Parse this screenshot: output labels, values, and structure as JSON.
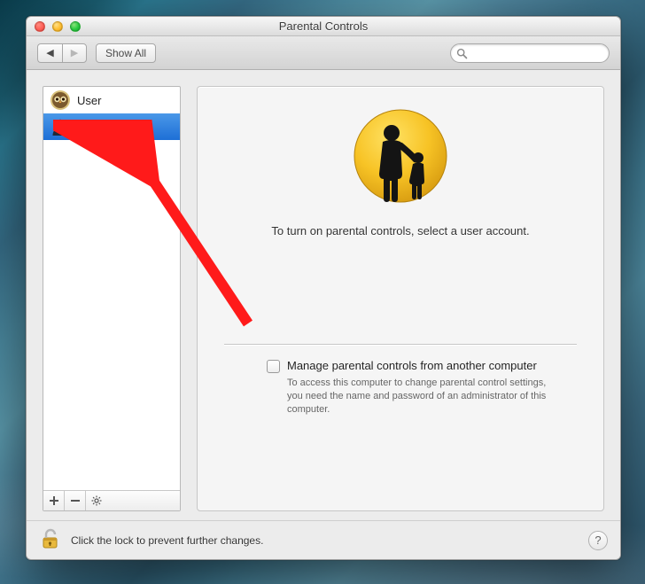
{
  "window": {
    "title": "Parental Controls"
  },
  "toolbar": {
    "show_all_label": "Show All",
    "search_placeholder": ""
  },
  "sidebar": {
    "users": [
      {
        "name": "User",
        "avatar": "owl",
        "selected": false
      },
      {
        "name": "Guest User",
        "avatar": "silhouette",
        "selected": true
      }
    ]
  },
  "detail": {
    "prompt": "To turn on parental controls, select a user account.",
    "manage_label": "Manage parental controls from another computer",
    "manage_desc": "To access this computer to change parental control settings, you need the name and password of an administrator of this computer.",
    "manage_checked": false
  },
  "footer": {
    "lock_text": "Click the lock to prevent further changes."
  },
  "annotation": {
    "type": "arrow",
    "color": "#ff1a1a",
    "target": "sidebar-item-guest-user"
  }
}
